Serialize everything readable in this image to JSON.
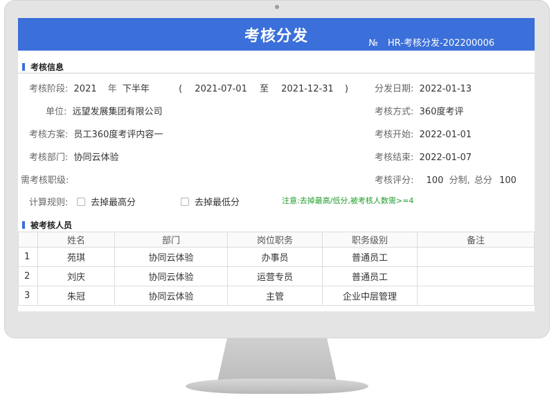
{
  "header": {
    "title": "考核分发",
    "no_symbol": "№",
    "doc_number": "HR-考核分发-202200006"
  },
  "sections": {
    "info": "考核信息",
    "people": "被考核人员"
  },
  "info": {
    "period": {
      "label": "考核阶段:",
      "year": "2021",
      "year_unit": "年",
      "half": "下半年",
      "lparen": "(",
      "start": "2021-07-01",
      "to": "至",
      "end": "2021-12-31",
      "rparen": ")"
    },
    "dist_date": {
      "label": "分发日期:",
      "value": "2022-01-13"
    },
    "unit": {
      "label": "单位:",
      "value": "远望发展集团有限公司"
    },
    "method": {
      "label": "考核方式:",
      "value": "360度考评"
    },
    "plan": {
      "label": "考核方案:",
      "value": "员工360度考评内容一"
    },
    "start": {
      "label": "考核开始:",
      "value": "2022-01-01"
    },
    "dept": {
      "label": "考核部门:",
      "value": "协同云体验"
    },
    "end": {
      "label": "考核结束:",
      "value": "2022-01-07"
    },
    "ranks": {
      "label": "需考核职级:",
      "value": ""
    },
    "score": {
      "label": "考核评分:",
      "value": "100",
      "unit": "分制,",
      "total_label": "总分",
      "total": "100"
    },
    "rules": {
      "label": "计算规则:",
      "option1": "去掉最高分",
      "option2": "去掉最低分",
      "note": "注意:去掉最高/低分,被考核人数需>=4"
    }
  },
  "table": {
    "headers": [
      "",
      "姓名",
      "部门",
      "岗位职务",
      "职务级别",
      "备注"
    ],
    "rows": [
      [
        "1",
        "苑琪",
        "协同云体验",
        "办事员",
        "普通员工",
        ""
      ],
      [
        "2",
        "刘庆",
        "协同云体验",
        "运营专员",
        "普通员工",
        ""
      ],
      [
        "3",
        "朱冠",
        "协同云体验",
        "主管",
        "企业中层管理",
        ""
      ]
    ]
  },
  "colors": {
    "accent": "#3b6fd9",
    "note": "#1f9d2a",
    "bezel": "#e4e4e4"
  }
}
